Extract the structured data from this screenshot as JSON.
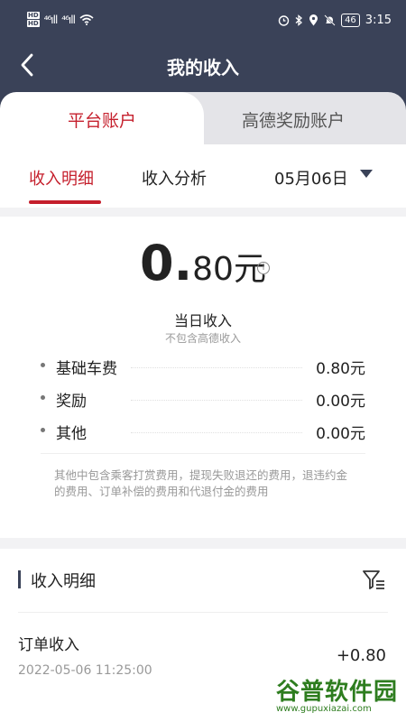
{
  "status_bar": {
    "hd_top": "HD",
    "hd_bottom": "HD",
    "sig1": "⁴⁶ıll",
    "sig2": "⁴⁶ıll",
    "battery": "46",
    "time": "3:15"
  },
  "header": {
    "back_icon": "chevron-left-icon",
    "title": "我的收入"
  },
  "account_tabs": [
    {
      "label": "平台账户",
      "active": true
    },
    {
      "label": "高德奖励账户",
      "active": false
    }
  ],
  "sub_tabs": {
    "details": "收入明细",
    "analysis": "收入分析",
    "date": "05月06日"
  },
  "summary": {
    "amount_int": "0.",
    "amount_rest": "80元",
    "day_label": "当日收入",
    "day_sub": "不包含高德收入",
    "rows": [
      {
        "name": "基础车费",
        "value": "0.80元"
      },
      {
        "name": "奖励",
        "value": "0.00元"
      },
      {
        "name": "其他",
        "value": "0.00元"
      }
    ],
    "note": "其他中包含乘客打赏费用，提现失败退还的费用，退违约金的费用、订单补偿的费用和代退付金的费用"
  },
  "detail": {
    "title": "收入明细",
    "items": [
      {
        "title": "订单收入",
        "time": "2022-05-06 11:25:00",
        "amount": "+0.80"
      }
    ]
  },
  "watermark": {
    "text": "谷普软件园",
    "url": "www.gupuxiazai.com"
  },
  "colors": {
    "header_bg": "#3a4258",
    "accent_red": "#c51f2c"
  }
}
